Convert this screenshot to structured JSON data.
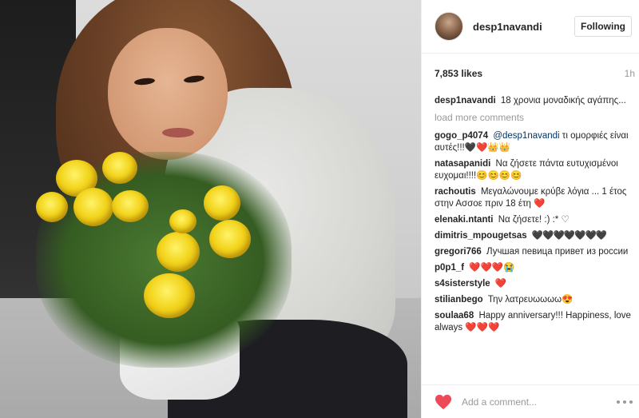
{
  "post": {
    "author": {
      "username": "desp1navandi",
      "avatar_icon": "profile-avatar"
    },
    "follow_button_label": "Following",
    "likes": "7,853 likes",
    "timestamp": "1h",
    "caption": {
      "user": "desp1navandi",
      "text": "18 χρονια μοναδικής αγάπης..."
    },
    "load_more_label": "load more comments",
    "comments": [
      {
        "user": "gogo_p4074",
        "mention": "@desp1navandi",
        "text": " τι ομορφιές είναι αυτές!!!",
        "emoji": "🖤❤️👑👑"
      },
      {
        "user": "natasapanidi",
        "text": "Να ζήσετε πάντα ευτυχισμένοι ευχομαι!!!!",
        "emoji": "😊😊😊😊"
      },
      {
        "user": "rachoutis",
        "text": "Μεγαλώνουμε κρύβε λόγια ... 1 έτος στην Ασσοε πριν 18 έτη",
        "emoji": "❤️"
      },
      {
        "user": "elenaki.ntanti",
        "text": "Να ζήσετε! :) :* ♡",
        "emoji": ""
      },
      {
        "user": "dimitris_mpougetsas",
        "text": "",
        "emoji": "🖤🖤🖤🖤🖤🖤🖤"
      },
      {
        "user": "gregori766",
        "text": "Лучшая певица привет из россии",
        "emoji": ""
      },
      {
        "user": "p0p1_f",
        "text": "",
        "emoji": "❤️❤️❤️😭"
      },
      {
        "user": "s4sisterstyle",
        "text": "",
        "emoji": "❤️"
      },
      {
        "user": "stilianbego",
        "text": "Την λατρευωωωω",
        "emoji": "😍"
      },
      {
        "user": "soulaa68",
        "text": "Happy anniversary!!! Happiness, love always",
        "emoji": "❤️❤️❤️"
      }
    ],
    "add_comment_placeholder": "Add a comment...",
    "colors": {
      "like_heart": "#ed4956",
      "mention": "#003569",
      "muted_text": "#999999",
      "border": "#efefef"
    }
  }
}
